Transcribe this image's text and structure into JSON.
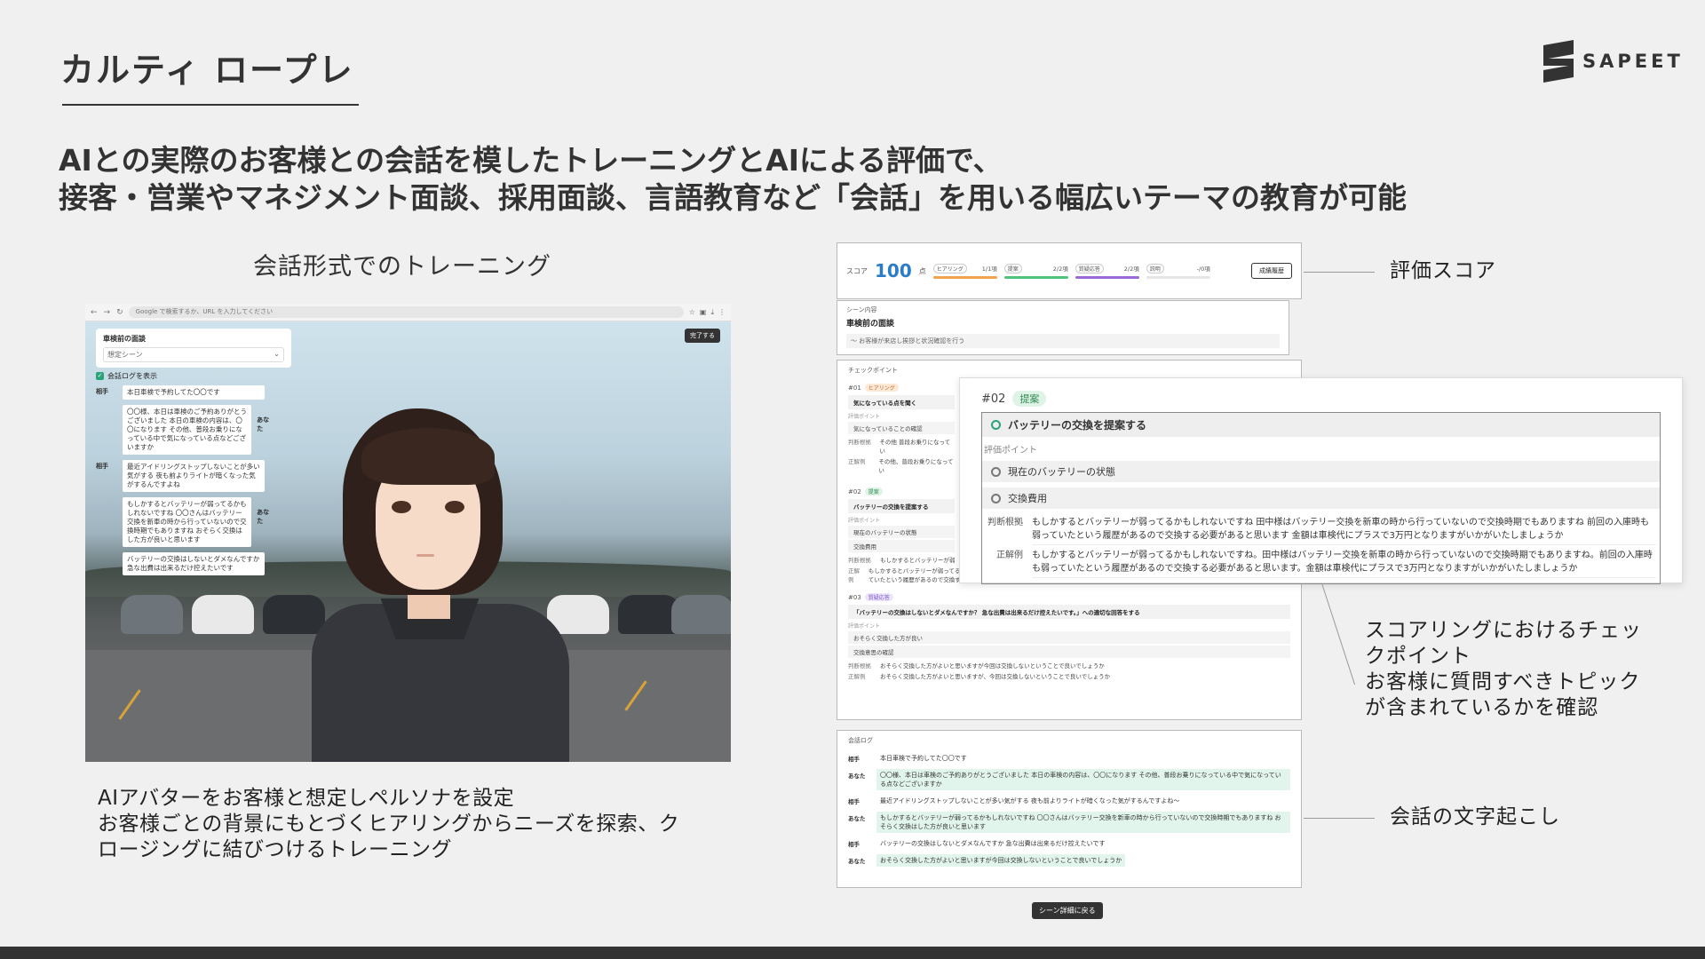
{
  "slide": {
    "title": "カルティ ロープレ",
    "logo_text": "SAPEET",
    "headline_line1": "AIとの実際のお客様との会話を模したトレーニングとAIによる評価で、",
    "headline_line2": "接客・営業やマネジメント面談、採用面談、言語教育など「会話」を用いる幅広いテーマの教育が可能"
  },
  "left": {
    "heading": "会話形式でのトレーニング",
    "desc_line1": "AIアバターをお客様と想定しペルソナを設定",
    "desc_line2": "お客様ごとの背景にもとづくヒアリングからニーズを探索、ク",
    "desc_line3": "ロージングに結びつけるトレーニング"
  },
  "browser": {
    "url_placeholder": "Google で検索するか、URL を入力してください",
    "scene_title": "車検前の面談",
    "scene_select": "想定シーン",
    "done_label": "完了する",
    "log_toggle": "会話ログを表示",
    "chat": [
      {
        "who": "相手",
        "text": "本日車検で予約してた〇〇です"
      },
      {
        "who": "あなた",
        "text": "〇〇様、本日は車検のご予約ありがとうございました 本日の車検の内容は、〇〇になります その他、普段お乗りになっている中で気になっている点などございますか"
      },
      {
        "who": "相手",
        "text": "最近アイドリングストップしないことが多い気がする 夜も前よりライトが暗くなった気がするんですよね"
      },
      {
        "who": "あなた",
        "text": "もしかするとバッテリーが弱ってるかもしれないですね 〇〇さんはバッテリー交換を新車の時から行っていないので交換時期でもありますね おそらく交換はした方が良いと思います"
      },
      {
        "who": "相手",
        "text": "バッテリーの交換はしないとダメなんですか 急な出費は出来るだけ控えたいです"
      }
    ]
  },
  "score": {
    "label": "スコア",
    "value": "100",
    "unit": "点",
    "categories": [
      {
        "name": "ヒアリング",
        "score": "1/1項",
        "color": "#f0a44c",
        "fill": 1.0
      },
      {
        "name": "提案",
        "score": "2/2項",
        "color": "#4cc47e",
        "fill": 1.0
      },
      {
        "name": "質疑応答",
        "score": "2/2項",
        "color": "#9a6ad6",
        "fill": 1.0
      },
      {
        "name": "説明",
        "score": "-/0項",
        "color": "#dddddd",
        "fill": 0.0
      }
    ],
    "history_btn": "成績履歴"
  },
  "scene_box": {
    "label": "シーン内容",
    "title": "車検前の面談",
    "desc": "〜 お客様が来店し挨拶と状況確認を行う"
  },
  "checkpoints": {
    "title": "チェックポイント",
    "items": [
      {
        "num": "#01",
        "tag": "ヒアリング",
        "main": "気になっている点を聞く",
        "sub": "評価ポイント",
        "points": [
          "気になっていることの確認"
        ],
        "k1": "判断根拠",
        "v1": "その他 普段お乗りになってい",
        "k2": "正解例",
        "v2": "その他、普段お乗りになってい"
      },
      {
        "num": "#02",
        "tag": "提案",
        "main": "バッテリーの交換を提案する",
        "sub": "評価ポイント",
        "points": [
          "現在のバッテリーの状態",
          "交換費用"
        ],
        "k1": "判断根拠",
        "v1": "もしかするとバッテリーが弱",
        "k2": "正解例",
        "v2": "もしかするとバッテリーが弱ってるかもしれないですね。田中様はバッテリー交換を新車の時から行っていないので交換時期でもありますね。前回の入庫時も弱っていたという履歴があるので交換する必要があると思います。金額は車検代にプラスで3万円になりますがいかがいたしましょうか"
      },
      {
        "num": "#03",
        "tag": "質疑応答",
        "main": "「バッテリーの交換はしないとダメなんですか？ 急な出費は出来るだけ控えたいです。」への適切な回答をする",
        "sub": "評価ポイント",
        "points": [
          "おそらく交換した方が良い",
          "交換意思の確認"
        ],
        "k1": "判断根拠",
        "v1": "おそらく交換した方がよいと思いますが今回は交換しないということで良いでしょうか",
        "k2": "正解例",
        "v2": "おそらく交換した方がよいと思いますが、今回は交換しないということで良いでしょうか"
      }
    ]
  },
  "zoom": {
    "num": "#02",
    "tag": "提案",
    "main": "バッテリーの交換を提案する",
    "sub": "評価ポイント",
    "point1": "現在のバッテリーの状態",
    "point2": "交換費用",
    "k1": "判断根拠",
    "v1": "もしかするとバッテリーが弱ってるかもしれないですね 田中様はバッテリー交換を新車の時から行っていないので交換時期でもありますね 前回の入庫時も弱っていたという履歴があるので交換する必要があると思います 金額は車検代にプラスで3万円となりますがいかがいたしましょうか",
    "k2": "正解例",
    "v2": "もしかするとバッテリーが弱ってるかもしれないですね。田中様はバッテリー交換を新車の時から行っていないので交換時期でもありますね。前回の入庫時も弱っていたという履歴があるので交換する必要があると思います。金額は車検代にプラスで3万円となりますがいかがいたしましょうか"
  },
  "log": {
    "title": "会話ログ",
    "rows": [
      {
        "who": "相手",
        "text": "本日車検で予約してた〇〇です",
        "me": false
      },
      {
        "who": "あなた",
        "text": "〇〇様、本日は車検のご予約ありがとうございました 本日の車検の内容は、〇〇になります その他、普段お乗りになっている中で気になっている点などございますか",
        "me": true
      },
      {
        "who": "相手",
        "text": "最近アイドリングストップしないことが多い気がする 夜も前よりライトが暗くなった気がするんですよね〜",
        "me": false
      },
      {
        "who": "あなた",
        "text": "もしかするとバッテリーが弱ってるかもしれないですね 〇〇さんはバッテリー交換を新車の時から行っていないので交換時期でもありますね おそらく交換はした方が良いと思います",
        "me": true
      },
      {
        "who": "相手",
        "text": "バッテリーの交換はしないとダメなんですか 急な出費は出来るだけ控えたいです",
        "me": false
      },
      {
        "who": "あなた",
        "text": "おそらく交換した方がよいと思いますが今回は交換しないということで良いでしょうか",
        "me": true
      }
    ],
    "back_btn": "シーン詳細に戻る"
  },
  "callouts": {
    "score": "評価スコア",
    "check_line1": "スコアリングにおけるチェッ",
    "check_line2": "クポイント",
    "check_line3": "お客様に質問すべきトピック",
    "check_line4": "が含まれているかを確認",
    "transcript": "会話の文字起こし"
  }
}
